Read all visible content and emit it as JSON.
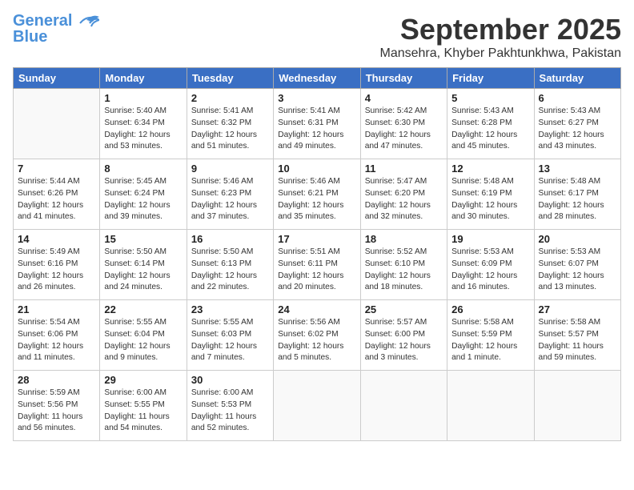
{
  "header": {
    "logo_general": "General",
    "logo_blue": "Blue",
    "month_title": "September 2025",
    "location": "Mansehra, Khyber Pakhtunkhwa, Pakistan"
  },
  "weekdays": [
    "Sunday",
    "Monday",
    "Tuesday",
    "Wednesday",
    "Thursday",
    "Friday",
    "Saturday"
  ],
  "weeks": [
    [
      {
        "day": null
      },
      {
        "day": 1,
        "sunrise": "5:40 AM",
        "sunset": "6:34 PM",
        "daylight": "12 hours and 53 minutes."
      },
      {
        "day": 2,
        "sunrise": "5:41 AM",
        "sunset": "6:32 PM",
        "daylight": "12 hours and 51 minutes."
      },
      {
        "day": 3,
        "sunrise": "5:41 AM",
        "sunset": "6:31 PM",
        "daylight": "12 hours and 49 minutes."
      },
      {
        "day": 4,
        "sunrise": "5:42 AM",
        "sunset": "6:30 PM",
        "daylight": "12 hours and 47 minutes."
      },
      {
        "day": 5,
        "sunrise": "5:43 AM",
        "sunset": "6:28 PM",
        "daylight": "12 hours and 45 minutes."
      },
      {
        "day": 6,
        "sunrise": "5:43 AM",
        "sunset": "6:27 PM",
        "daylight": "12 hours and 43 minutes."
      }
    ],
    [
      {
        "day": 7,
        "sunrise": "5:44 AM",
        "sunset": "6:26 PM",
        "daylight": "12 hours and 41 minutes."
      },
      {
        "day": 8,
        "sunrise": "5:45 AM",
        "sunset": "6:24 PM",
        "daylight": "12 hours and 39 minutes."
      },
      {
        "day": 9,
        "sunrise": "5:46 AM",
        "sunset": "6:23 PM",
        "daylight": "12 hours and 37 minutes."
      },
      {
        "day": 10,
        "sunrise": "5:46 AM",
        "sunset": "6:21 PM",
        "daylight": "12 hours and 35 minutes."
      },
      {
        "day": 11,
        "sunrise": "5:47 AM",
        "sunset": "6:20 PM",
        "daylight": "12 hours and 32 minutes."
      },
      {
        "day": 12,
        "sunrise": "5:48 AM",
        "sunset": "6:19 PM",
        "daylight": "12 hours and 30 minutes."
      },
      {
        "day": 13,
        "sunrise": "5:48 AM",
        "sunset": "6:17 PM",
        "daylight": "12 hours and 28 minutes."
      }
    ],
    [
      {
        "day": 14,
        "sunrise": "5:49 AM",
        "sunset": "6:16 PM",
        "daylight": "12 hours and 26 minutes."
      },
      {
        "day": 15,
        "sunrise": "5:50 AM",
        "sunset": "6:14 PM",
        "daylight": "12 hours and 24 minutes."
      },
      {
        "day": 16,
        "sunrise": "5:50 AM",
        "sunset": "6:13 PM",
        "daylight": "12 hours and 22 minutes."
      },
      {
        "day": 17,
        "sunrise": "5:51 AM",
        "sunset": "6:11 PM",
        "daylight": "12 hours and 20 minutes."
      },
      {
        "day": 18,
        "sunrise": "5:52 AM",
        "sunset": "6:10 PM",
        "daylight": "12 hours and 18 minutes."
      },
      {
        "day": 19,
        "sunrise": "5:53 AM",
        "sunset": "6:09 PM",
        "daylight": "12 hours and 16 minutes."
      },
      {
        "day": 20,
        "sunrise": "5:53 AM",
        "sunset": "6:07 PM",
        "daylight": "12 hours and 13 minutes."
      }
    ],
    [
      {
        "day": 21,
        "sunrise": "5:54 AM",
        "sunset": "6:06 PM",
        "daylight": "12 hours and 11 minutes."
      },
      {
        "day": 22,
        "sunrise": "5:55 AM",
        "sunset": "6:04 PM",
        "daylight": "12 hours and 9 minutes."
      },
      {
        "day": 23,
        "sunrise": "5:55 AM",
        "sunset": "6:03 PM",
        "daylight": "12 hours and 7 minutes."
      },
      {
        "day": 24,
        "sunrise": "5:56 AM",
        "sunset": "6:02 PM",
        "daylight": "12 hours and 5 minutes."
      },
      {
        "day": 25,
        "sunrise": "5:57 AM",
        "sunset": "6:00 PM",
        "daylight": "12 hours and 3 minutes."
      },
      {
        "day": 26,
        "sunrise": "5:58 AM",
        "sunset": "5:59 PM",
        "daylight": "12 hours and 1 minute."
      },
      {
        "day": 27,
        "sunrise": "5:58 AM",
        "sunset": "5:57 PM",
        "daylight": "11 hours and 59 minutes."
      }
    ],
    [
      {
        "day": 28,
        "sunrise": "5:59 AM",
        "sunset": "5:56 PM",
        "daylight": "11 hours and 56 minutes."
      },
      {
        "day": 29,
        "sunrise": "6:00 AM",
        "sunset": "5:55 PM",
        "daylight": "11 hours and 54 minutes."
      },
      {
        "day": 30,
        "sunrise": "6:00 AM",
        "sunset": "5:53 PM",
        "daylight": "11 hours and 52 minutes."
      },
      {
        "day": null
      },
      {
        "day": null
      },
      {
        "day": null
      },
      {
        "day": null
      }
    ]
  ]
}
